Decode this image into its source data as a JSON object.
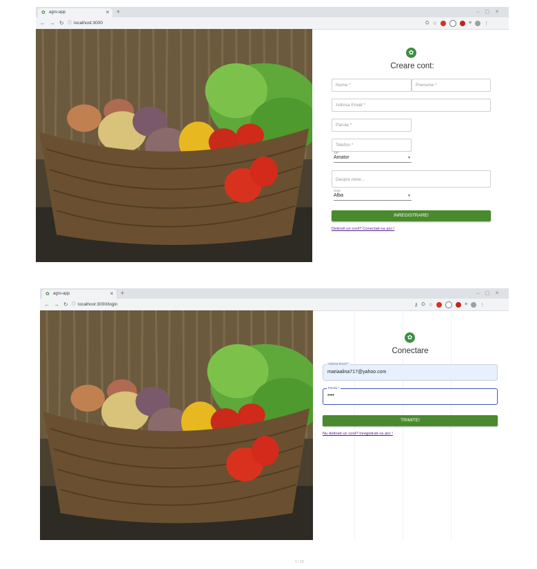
{
  "shots": [
    {
      "tab_title": "agro-app",
      "url": "localhost:3000",
      "form": {
        "title": "Creare cont:",
        "fields": {
          "nume": "Nume *",
          "prenume": "Prenume *",
          "email": "Adresa Email *",
          "parola": "Parola *",
          "telefon": "Telefon *",
          "despre": "Despre mine..."
        },
        "tip": {
          "label": "TIP",
          "value": "Amator"
        },
        "oras": {
          "label": "Oras",
          "value": "Alba"
        },
        "submit": "INREGISTRARE!",
        "link": "Detineti un cont? Conectati-va aici !"
      }
    },
    {
      "tab_title": "agro-app",
      "url": "localhost:3000/login",
      "form": {
        "title": "Conectare",
        "email_label": "Adresa Email *",
        "email_value": "mariaalina717@yahoo.com",
        "parola_label": "Parola *",
        "parola_value": "••••",
        "submit": "TRIMITE!",
        "link": "Nu detineti un cont? Inregistrati-va aici !"
      }
    }
  ],
  "colors": {
    "accent": "#4a8a2e",
    "logo": "#3e8e41",
    "autofill": "#e8f0fe",
    "focus": "#3f51b5"
  },
  "icons": [
    "plant-icon",
    "close-icon",
    "plus-icon",
    "back-arrow-icon",
    "forward-arrow-icon",
    "reload-icon",
    "info-icon",
    "key-icon",
    "translate-icon",
    "star-icon",
    "user-avatar-icon",
    "menu-icon"
  ],
  "footer_mark": "1 / 10"
}
